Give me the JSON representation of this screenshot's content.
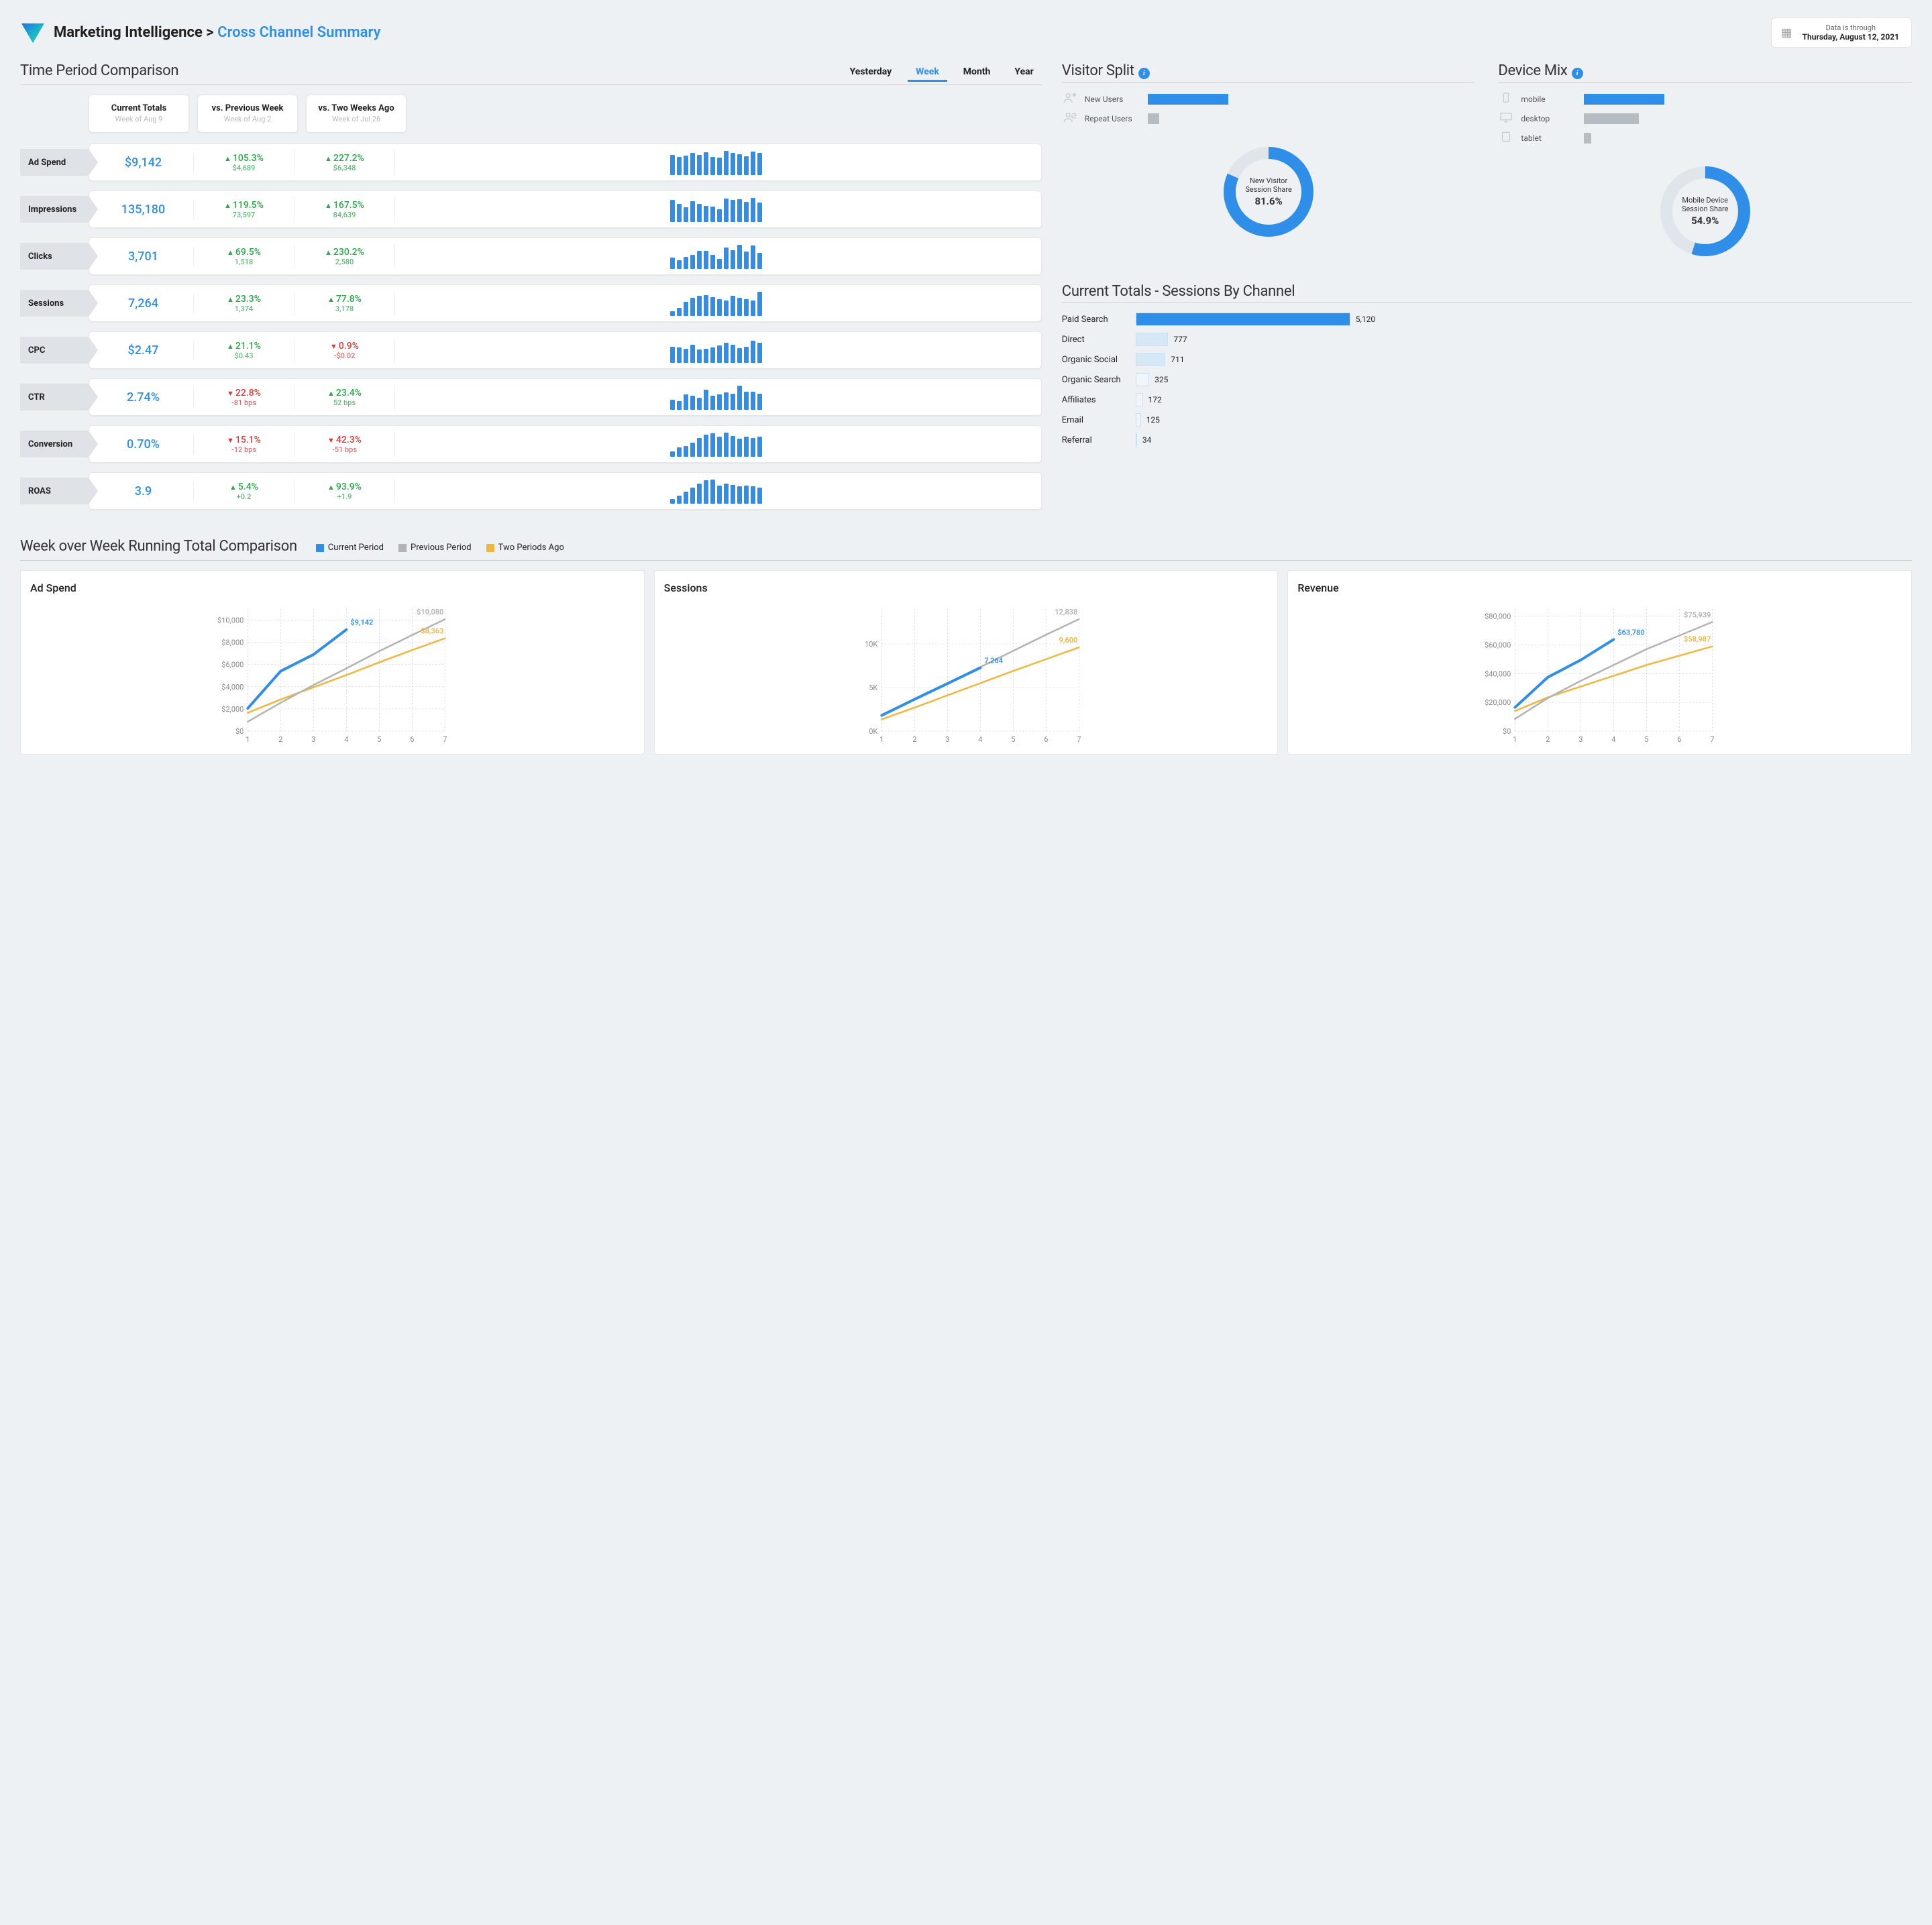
{
  "header": {
    "breadcrumb_root": "Marketing Intelligence",
    "breadcrumb_sep": " > ",
    "breadcrumb_page": "Cross Channel Summary",
    "date_caption": "Data is through",
    "date_value": "Thursday, August 12, 2021"
  },
  "time_period": {
    "title": "Time Period Comparison",
    "tabs": [
      "Yesterday",
      "Week",
      "Month",
      "Year"
    ],
    "active_tab": "Week",
    "col_headers": [
      {
        "title": "Current Totals",
        "sub": "Week of Aug 9"
      },
      {
        "title": "vs. Previous Week",
        "sub": "Week of Aug 2"
      },
      {
        "title": "vs. Two Weeks Ago",
        "sub": "Week of Jul 26"
      }
    ],
    "metrics": [
      {
        "label": "Ad Spend",
        "value": "$9,142",
        "d1": {
          "dir": "up",
          "pct": "105.3%",
          "sub": "$4,689"
        },
        "d2": {
          "dir": "up",
          "pct": "227.2%",
          "sub": "$6,348"
        },
        "spark": [
          78,
          72,
          76,
          88,
          80,
          90,
          72,
          68,
          96,
          88,
          82,
          74,
          92,
          86
        ]
      },
      {
        "label": "Impressions",
        "value": "135,180",
        "d1": {
          "dir": "up",
          "pct": "119.5%",
          "sub": "73,597"
        },
        "d2": {
          "dir": "up",
          "pct": "167.5%",
          "sub": "84,639"
        },
        "spark": [
          86,
          72,
          58,
          82,
          70,
          64,
          60,
          50,
          92,
          86,
          90,
          78,
          96,
          76
        ]
      },
      {
        "label": "Clicks",
        "value": "3,701",
        "d1": {
          "dir": "up",
          "pct": "69.5%",
          "sub": "1,518"
        },
        "d2": {
          "dir": "up",
          "pct": "230.2%",
          "sub": "2,580"
        },
        "spark": [
          46,
          34,
          48,
          56,
          70,
          72,
          54,
          40,
          84,
          74,
          96,
          68,
          92,
          62
        ]
      },
      {
        "label": "Sessions",
        "value": "7,264",
        "d1": {
          "dir": "up",
          "pct": "23.3%",
          "sub": "1,374"
        },
        "d2": {
          "dir": "up",
          "pct": "77.8%",
          "sub": "3,178"
        },
        "spark": [
          18,
          32,
          54,
          72,
          80,
          82,
          74,
          66,
          60,
          78,
          72,
          66,
          60,
          94
        ]
      },
      {
        "label": "CPC",
        "value": "$2.47",
        "d1": {
          "dir": "up",
          "pct": "21.1%",
          "sub": "$0.43"
        },
        "d2": {
          "dir": "down",
          "pct": "0.9%",
          "sub": "-$0.02"
        },
        "spark": [
          64,
          60,
          54,
          70,
          52,
          56,
          60,
          68,
          80,
          72,
          58,
          64,
          88,
          78
        ]
      },
      {
        "label": "CTR",
        "value": "2.74%",
        "d1": {
          "dir": "down",
          "pct": "22.8%",
          "sub": "-81 bps"
        },
        "d2": {
          "dir": "up",
          "pct": "23.4%",
          "sub": "52 bps"
        },
        "spark": [
          40,
          34,
          60,
          56,
          48,
          80,
          56,
          60,
          68,
          64,
          96,
          70,
          72,
          64
        ]
      },
      {
        "label": "Conversion",
        "value": "0.70%",
        "d1": {
          "dir": "down",
          "pct": "15.1%",
          "sub": "-12 bps"
        },
        "d2": {
          "dir": "down",
          "pct": "42.3%",
          "sub": "-51 bps"
        },
        "spark": [
          22,
          36,
          42,
          56,
          74,
          88,
          92,
          78,
          94,
          82,
          70,
          78,
          74,
          80
        ]
      },
      {
        "label": "ROAS",
        "value": "3.9",
        "d1": {
          "dir": "up",
          "pct": "5.4%",
          "sub": "+0.2"
        },
        "d2": {
          "dir": "up",
          "pct": "93.9%",
          "sub": "+1.9"
        },
        "spark": [
          18,
          32,
          48,
          62,
          78,
          92,
          96,
          72,
          80,
          74,
          68,
          72,
          68,
          62
        ]
      }
    ]
  },
  "visitor_split": {
    "title": "Visitor Split",
    "rows": [
      {
        "icon": "new-user-icon",
        "label": "New Users",
        "color": "#2f8fe8",
        "width": 100
      },
      {
        "icon": "repeat-user-icon",
        "label": "Repeat Users",
        "color": "#b7bcc1",
        "width": 14
      }
    ],
    "donut": {
      "label1": "New Visitor",
      "label2": "Session Share",
      "value": "81.6%",
      "pct": 81.6
    }
  },
  "device_mix": {
    "title": "Device Mix",
    "rows": [
      {
        "icon": "mobile-icon",
        "label": "mobile",
        "color": "#2f8fe8",
        "width": 100
      },
      {
        "icon": "desktop-icon",
        "label": "desktop",
        "color": "#b7bcc1",
        "width": 68
      },
      {
        "icon": "tablet-icon",
        "label": "tablet",
        "color": "#b7bcc1",
        "width": 9
      }
    ],
    "donut": {
      "label1": "Mobile Device",
      "label2": "Session Share",
      "value": "54.9%",
      "pct": 54.9
    }
  },
  "sessions_by_channel": {
    "title": "Current Totals - Sessions By Channel",
    "max": 5120,
    "rows": [
      {
        "label": "Paid Search",
        "value": 5120,
        "fmt": "5,120",
        "color": "#2f8fe8"
      },
      {
        "label": "Direct",
        "value": 777,
        "fmt": "777",
        "color": "#d6e8f7"
      },
      {
        "label": "Organic Social",
        "value": 711,
        "fmt": "711",
        "color": "#d6e8f7"
      },
      {
        "label": "Organic Search",
        "value": 325,
        "fmt": "325",
        "color": "#f0f5fb"
      },
      {
        "label": "Affiliates",
        "value": 172,
        "fmt": "172",
        "color": "#f0f5fb"
      },
      {
        "label": "Email",
        "value": 125,
        "fmt": "125",
        "color": "#f0f5fb"
      },
      {
        "label": "Referral",
        "value": 34,
        "fmt": "34",
        "color": "#f0f5fb"
      }
    ]
  },
  "wow": {
    "title": "Week over Week Running Total Comparison",
    "legend": [
      {
        "label": "Current Period",
        "color": "#2f8fe8"
      },
      {
        "label": "Previous Period",
        "color": "#b3b3b3"
      },
      {
        "label": "Two Periods Ago",
        "color": "#f1b73c"
      }
    ]
  },
  "chart_data": [
    {
      "type": "line",
      "title": "Ad Spend",
      "xlabel": "",
      "ylabel": "",
      "x": [
        1,
        2,
        3,
        4,
        5,
        6,
        7
      ],
      "ylim": [
        0,
        11000
      ],
      "yticks": [
        0,
        2000,
        4000,
        6000,
        8000,
        10000
      ],
      "yticks_fmt": [
        "$0",
        "$2,000",
        "$4,000",
        "$6,000",
        "$8,000",
        "$10,000"
      ],
      "series": [
        {
          "name": "Current Period",
          "color": "#2f8fe8",
          "values": [
            2050,
            5400,
            6900,
            9142,
            null,
            null,
            null
          ],
          "label_end": "$9,142"
        },
        {
          "name": "Previous Period",
          "color": "#b3b3b3",
          "values": [
            850,
            2550,
            4150,
            5650,
            7200,
            8650,
            10080
          ],
          "label_end": "$10,080"
        },
        {
          "name": "Two Periods Ago",
          "color": "#f1b73c",
          "values": [
            1650,
            2850,
            3950,
            5050,
            6200,
            7300,
            8363
          ],
          "label_end": "$8,363"
        }
      ]
    },
    {
      "type": "line",
      "title": "Sessions",
      "xlabel": "",
      "ylabel": "",
      "x": [
        1,
        2,
        3,
        4,
        5,
        6,
        7
      ],
      "ylim": [
        0,
        14000
      ],
      "yticks": [
        0,
        5000,
        10000
      ],
      "yticks_fmt": [
        "0K",
        "5K",
        "10K"
      ],
      "series": [
        {
          "name": "Current Period",
          "color": "#2f8fe8",
          "values": [
            1800,
            3650,
            5450,
            7264,
            null,
            null,
            null
          ],
          "label_end": "7,264"
        },
        {
          "name": "Previous Period",
          "color": "#b3b3b3",
          "values": [
            1750,
            3600,
            5500,
            7350,
            9200,
            11050,
            12838
          ],
          "label_end": "12,838"
        },
        {
          "name": "Two Periods Ago",
          "color": "#f1b73c",
          "values": [
            1350,
            2700,
            4100,
            5500,
            6900,
            8250,
            9600
          ],
          "label_end": "9,600"
        }
      ]
    },
    {
      "type": "line",
      "title": "Revenue",
      "xlabel": "",
      "ylabel": "",
      "x": [
        1,
        2,
        3,
        4,
        5,
        6,
        7
      ],
      "ylim": [
        0,
        85000
      ],
      "yticks": [
        0,
        20000,
        40000,
        60000,
        80000
      ],
      "yticks_fmt": [
        "$0",
        "$20,000",
        "$40,000",
        "$60,000",
        "$80,000"
      ],
      "series": [
        {
          "name": "Current Period",
          "color": "#2f8fe8",
          "values": [
            16500,
            37500,
            49500,
            63780,
            null,
            null,
            null
          ],
          "label_end": "$63,780"
        },
        {
          "name": "Previous Period",
          "color": "#b3b3b3",
          "values": [
            8500,
            23000,
            35000,
            46000,
            57000,
            66500,
            75939
          ],
          "label_end": "$75,939"
        },
        {
          "name": "Two Periods Ago",
          "color": "#f1b73c",
          "values": [
            14000,
            23500,
            31000,
            38500,
            46000,
            52500,
            58987
          ],
          "label_end": "$58,987"
        }
      ]
    }
  ]
}
